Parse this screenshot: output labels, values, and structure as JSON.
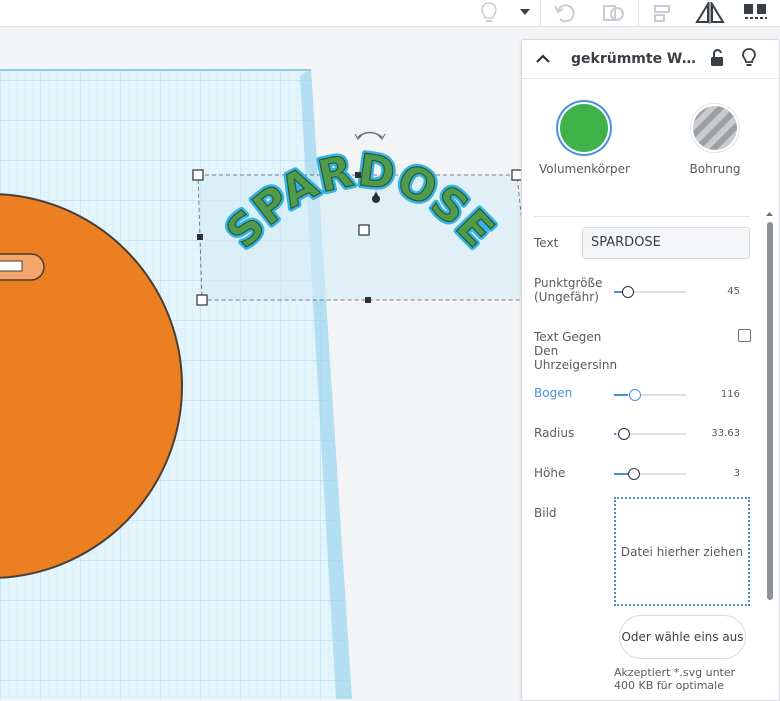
{
  "toolbar": {
    "icons": [
      "lightbulb-icon",
      "dropdown-caret-icon",
      "undo-icon",
      "duplicate-icon",
      "align-icon",
      "mirror-icon",
      "group-icon"
    ]
  },
  "inspector": {
    "title": "gekrümmte Wör...",
    "solid_label": "Volumenkörper",
    "hole_label": "Bohrung",
    "solid_color": "#3fb24a",
    "text_label": "Text",
    "text_value": "SPARDOSE",
    "size_label_1": "Punktgröße",
    "size_label_2": "(Ungefähr)",
    "size_value": "45",
    "ccw_label_1": "Text Gegen",
    "ccw_label_2": "Den",
    "ccw_label_3": "Uhrzeigersinn",
    "ccw_checked": false,
    "arc_label": "Bogen",
    "arc_value": "116",
    "radius_label": "Radius",
    "radius_value": "33.63",
    "height_label": "Höhe",
    "height_value": "3",
    "image_label": "Bild",
    "dropzone_text": "Datei hierher ziehen",
    "choose_button": "Oder wähle eins aus",
    "accept_note": "Akzeptiert *.svg unter 400 KB für optimale"
  },
  "scene": {
    "curved_text": "SPARDOSE",
    "disc_color": "#ec7f22",
    "text_color": "#4f9a4c",
    "text_outline_color": "#34b4e8"
  }
}
